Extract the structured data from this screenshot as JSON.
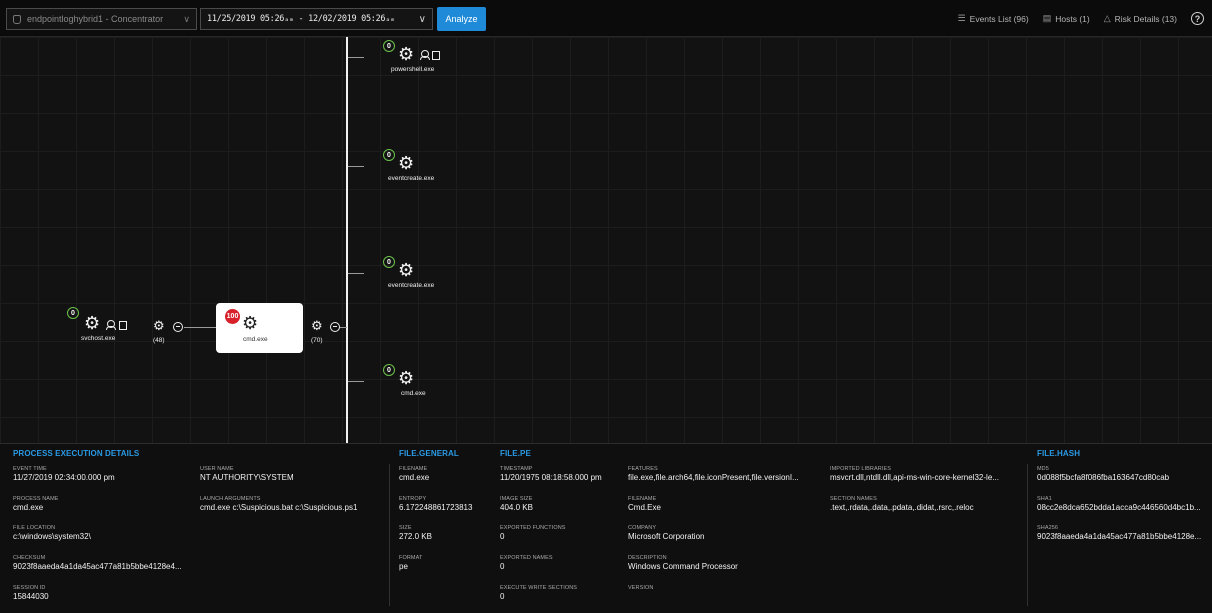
{
  "toolbar": {
    "service": "endpointloghybrid1 - Concentrator",
    "time_range": "11/25/2019 05:26ₐₘ - 12/02/2019 05:26ₐₘ",
    "analyze": "Analyze",
    "events_list": "Events List (96)",
    "hosts": "Hosts (1)",
    "risk_details": "Risk Details (13)",
    "help": "?"
  },
  "graph": {
    "parent": {
      "label": "svchost.exe",
      "badge": "0",
      "children_count": "(48)"
    },
    "focus": {
      "label": "cmd.exe",
      "risk": "100",
      "children_count": "(70)"
    },
    "children": [
      {
        "label": "powershell.exe",
        "badge": "0"
      },
      {
        "label": "eventcreate.exe",
        "badge": "0"
      },
      {
        "label": "eventcreate.exe",
        "badge": "0"
      },
      {
        "label": "cmd.exe",
        "badge": "0"
      }
    ]
  },
  "details": {
    "process_execution": {
      "title": "PROCESS EXECUTION DETAILS",
      "event_time": {
        "k": "EVENT TIME",
        "v": "11/27/2019 02:34:00.000 pm"
      },
      "user_name": {
        "k": "USER NAME",
        "v": "NT AUTHORITY\\SYSTEM"
      },
      "process_name": {
        "k": "PROCESS NAME",
        "v": "cmd.exe"
      },
      "launch_args": {
        "k": "LAUNCH ARGUMENTS",
        "v": "cmd.exe c:\\Suspicious.bat c:\\Suspicious.ps1"
      },
      "file_location": {
        "k": "FILE LOCATION",
        "v": "c:\\windows\\system32\\"
      },
      "checksum": {
        "k": "CHECKSUM",
        "v": "9023f8aaeda4a1da45ac477a81b5bbe4128e4..."
      },
      "session_id": {
        "k": "SESSION ID",
        "v": "15844030"
      }
    },
    "file_general": {
      "title": "FILE.GENERAL",
      "filename": {
        "k": "FILENAME",
        "v": "cmd.exe"
      },
      "entropy": {
        "k": "ENTROPY",
        "v": "6.172248861723813"
      },
      "size": {
        "k": "SIZE",
        "v": "272.0 KB"
      },
      "format": {
        "k": "FORMAT",
        "v": "pe"
      }
    },
    "file_pe": {
      "title": "FILE.PE",
      "timestamp": {
        "k": "TIMESTAMP",
        "v": "11/20/1975 08:18:58.000 pm"
      },
      "image_size": {
        "k": "IMAGE SIZE",
        "v": "404.0 KB"
      },
      "exported_functions": {
        "k": "EXPORTED FUNCTIONS",
        "v": "0"
      },
      "exported_names": {
        "k": "EXPORTED NAMES",
        "v": "0"
      },
      "execute_write_sections": {
        "k": "EXECUTE WRITE SECTIONS",
        "v": "0"
      },
      "features": {
        "k": "FEATURES",
        "v": "file.exe,file.arch64,file.iconPresent,file.versionI..."
      },
      "filename": {
        "k": "FILENAME",
        "v": "Cmd.Exe"
      },
      "company": {
        "k": "COMPANY",
        "v": "Microsoft Corporation"
      },
      "description": {
        "k": "DESCRIPTION",
        "v": "Windows Command Processor"
      },
      "version": {
        "k": "VERSION",
        "v": ""
      },
      "imported_libraries": {
        "k": "IMPORTED LIBRARIES",
        "v": "msvcrt.dll,ntdll.dll,api-ms-win-core-kernel32-le..."
      },
      "section_names": {
        "k": "SECTION NAMES",
        "v": ".text,.rdata,.data,.pdata,.didat,.rsrc,.reloc"
      }
    },
    "file_hash": {
      "title": "FILE.HASH",
      "md5": {
        "k": "MD5",
        "v": "0d088f5bcfa8f086fba163647cd80cab"
      },
      "sha1": {
        "k": "SHA1",
        "v": "08cc2e8dca652bdda1acca9c446560d4bc1b..."
      },
      "sha256": {
        "k": "SHA256",
        "v": "9023f8aaeda4a1da45ac477a81b5bbe4128e..."
      }
    }
  }
}
